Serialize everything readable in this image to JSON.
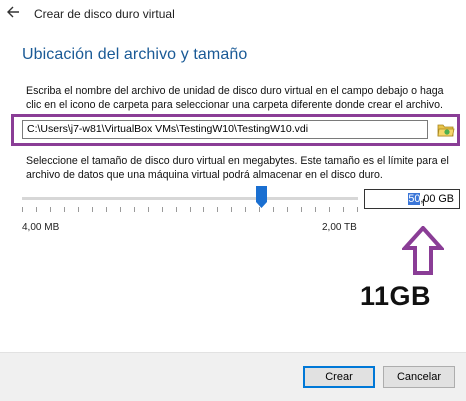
{
  "window": {
    "title": "Crear de disco duro virtual",
    "back_icon": "back-arrow-icon"
  },
  "section": {
    "heading": "Ubicación del archivo y tamaño"
  },
  "location": {
    "description_line1": "Escriba el nombre del archivo de unidad de disco duro virtual en el campo debajo o haga",
    "description_line2": "clic en el icono de carpeta para seleccionar una carpeta diferente donde crear el archivo.",
    "path_value": "C:\\Users\\j7-w81\\VirtualBox VMs\\TestingW10\\TestingW10.vdi",
    "folder_icon": "folder-icon",
    "highlight_color": "#8a3d96"
  },
  "size": {
    "description_line1": "Seleccione el tamaño de disco duro virtual en megabytes. Este tamaño es el límite para el",
    "description_line2": "archivo de datos que una máquina virtual podrá almacenar en el disco duro.",
    "value_selected_part": "50",
    "value_rest": ",00 GB",
    "min_label": "4,00 MB",
    "max_label": "2,00 TB",
    "slider_level": 0.71,
    "thumb_color": "#1a6fd1"
  },
  "annotation": {
    "text": "11GB",
    "arrow_color": "#8a3d96",
    "arrow_icon": "up-arrow-icon"
  },
  "buttons": {
    "create": "Crear",
    "cancel": "Cancelar"
  }
}
